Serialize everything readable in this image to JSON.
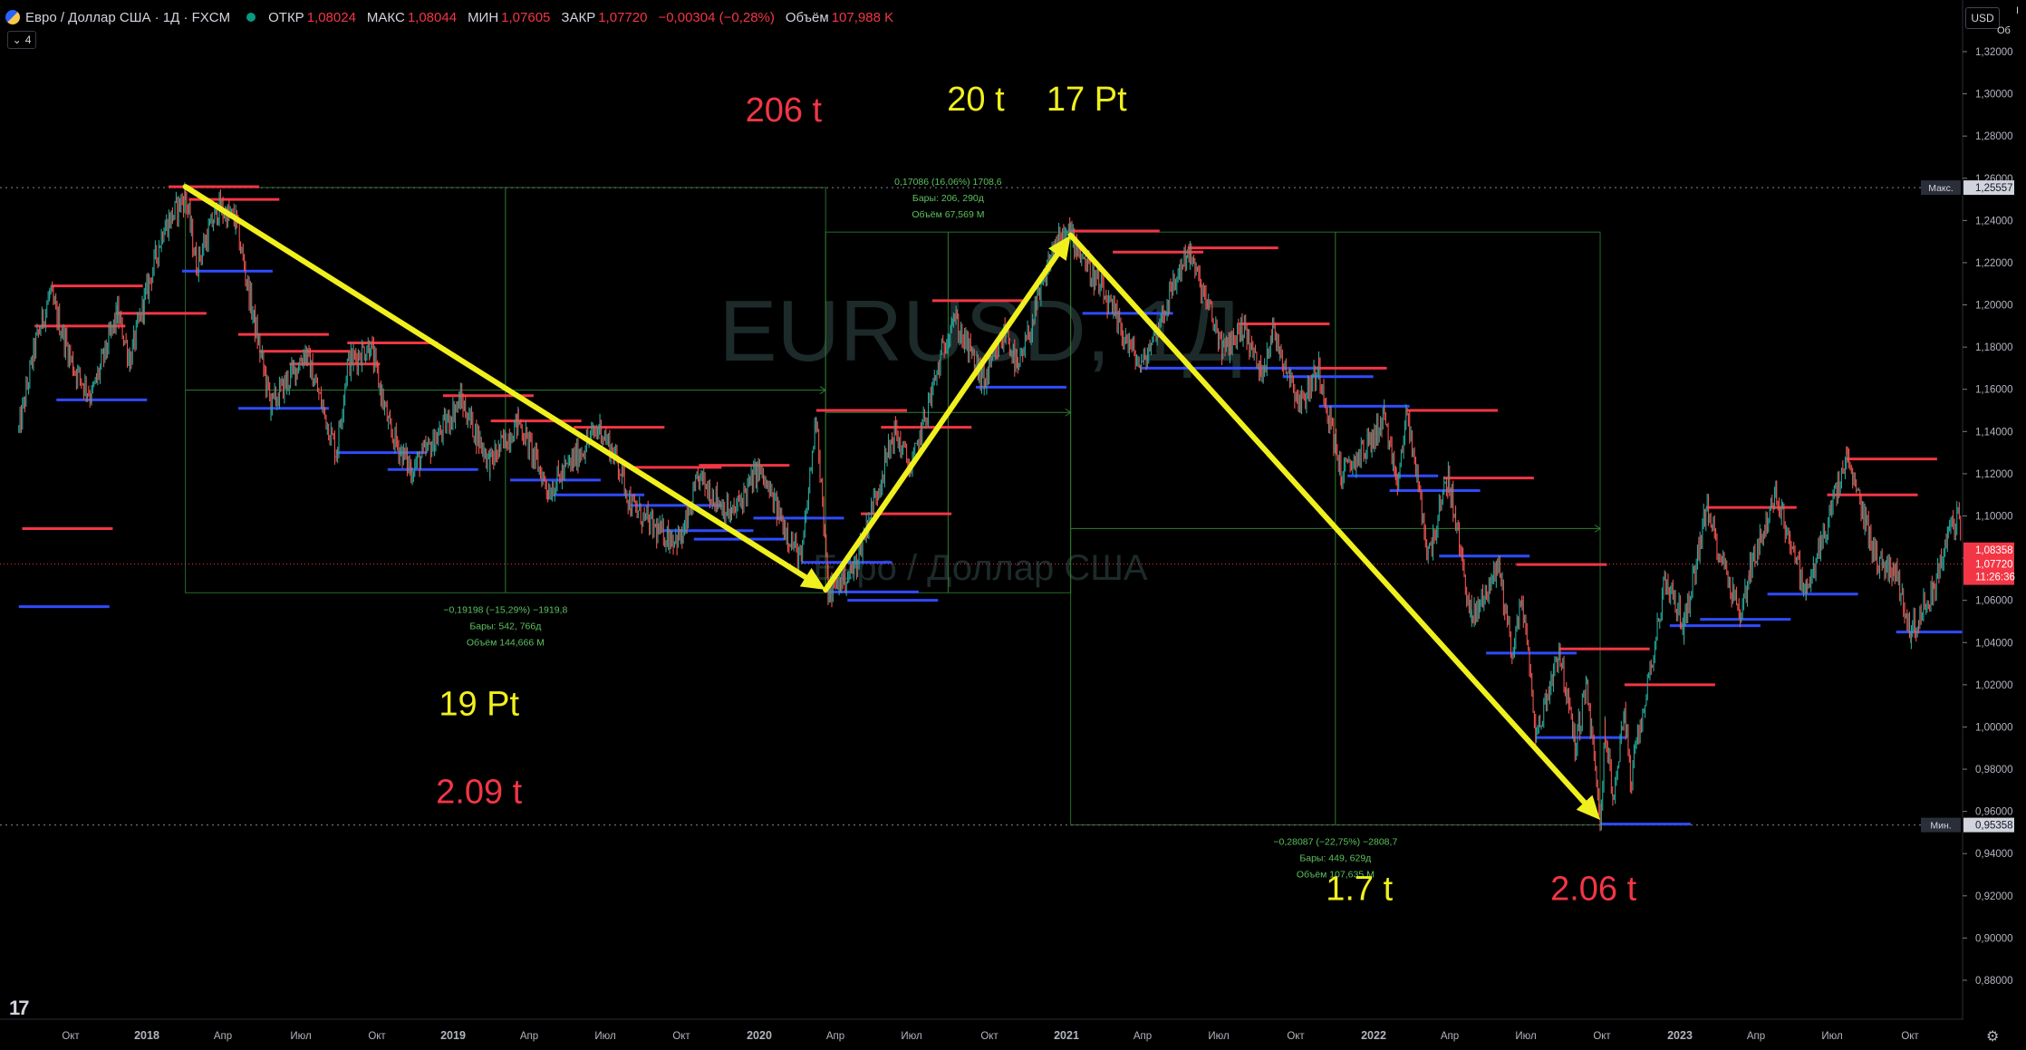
{
  "header": {
    "title": "Евро / Доллар США · 1Д · FXCM",
    "open_label": "ОТКР",
    "open": "1,08024",
    "high_label": "МАКС",
    "high": "1,08044",
    "low_label": "МИН",
    "low": "1,07605",
    "close_label": "ЗАКР",
    "close": "1,07720",
    "change": "−0,00304 (−0,28%)",
    "volume_label": "Объём",
    "volume": "107,988 K"
  },
  "indicator_toggle": {
    "chevron": "⌄",
    "count": "4"
  },
  "currency_button": "USD",
  "edge_chars": [
    "I",
    "Об"
  ],
  "watermark": {
    "symbol": "EURUSD, 1Д",
    "name": "Евро / Доллар США"
  },
  "chart_data": {
    "type": "line",
    "title": "Евро / Доллар США · 1Д · FXCM",
    "ylim": [
      0.87,
      1.335
    ],
    "y_ticks": [
      "1,32000",
      "1,30000",
      "1,28000",
      "1,26000",
      "1,24000",
      "1,22000",
      "1,20000",
      "1,18000",
      "1,16000",
      "1,14000",
      "1,12000",
      "1,10000",
      "1,08000",
      "1,06000",
      "1,04000",
      "1,02000",
      "1,00000",
      "0,98000",
      "0,96000",
      "0,94000",
      "0,92000",
      "0,90000",
      "0,88000"
    ],
    "x_ticks": [
      "Окт",
      "2018",
      "Апр",
      "Июл",
      "Окт",
      "2019",
      "Апр",
      "Июл",
      "Окт",
      "2020",
      "Апр",
      "Июл",
      "Окт",
      "2021",
      "Апр",
      "Июл",
      "Окт",
      "2022",
      "Апр",
      "Июл",
      "Окт",
      "2023",
      "Апр",
      "Июл",
      "Окт"
    ],
    "x_ticks_bold": [
      "2018",
      "2019",
      "2020",
      "2021",
      "2022",
      "2023"
    ],
    "series": [
      {
        "values": [
          [
            "2017-08-01",
            1.14
          ],
          [
            "2017-08-20",
            1.18
          ],
          [
            "2017-09-07",
            1.205
          ],
          [
            "2017-10-06",
            1.17
          ],
          [
            "2017-10-27",
            1.157
          ],
          [
            "2017-11-27",
            1.196
          ],
          [
            "2017-12-12",
            1.174
          ],
          [
            "2017-12-29",
            1.202
          ],
          [
            "2018-01-20",
            1.235
          ],
          [
            "2018-02-16",
            1.252
          ],
          [
            "2018-03-01",
            1.219
          ],
          [
            "2018-03-27",
            1.246
          ],
          [
            "2018-04-17",
            1.24
          ],
          [
            "2018-05-10",
            1.19
          ],
          [
            "2018-05-29",
            1.152
          ],
          [
            "2018-06-14",
            1.162
          ],
          [
            "2018-06-28",
            1.17
          ],
          [
            "2018-07-09",
            1.178
          ],
          [
            "2018-08-15",
            1.13
          ],
          [
            "2018-08-28",
            1.172
          ],
          [
            "2018-09-24",
            1.181
          ],
          [
            "2018-10-18",
            1.14
          ],
          [
            "2018-11-12",
            1.122
          ],
          [
            "2018-12-10",
            1.135
          ],
          [
            "2019-01-10",
            1.155
          ],
          [
            "2019-02-14",
            1.125
          ],
          [
            "2019-03-20",
            1.145
          ],
          [
            "2019-04-25",
            1.112
          ],
          [
            "2019-06-25",
            1.142
          ],
          [
            "2019-07-17",
            1.125
          ],
          [
            "2019-08-01",
            1.105
          ],
          [
            "2019-09-03",
            1.092
          ],
          [
            "2019-10-01",
            1.089
          ],
          [
            "2019-10-21",
            1.118
          ],
          [
            "2019-11-29",
            1.1
          ],
          [
            "2019-12-31",
            1.122
          ],
          [
            "2020-02-20",
            1.078
          ],
          [
            "2020-03-09",
            1.149
          ],
          [
            "2020-03-23",
            1.064
          ],
          [
            "2020-04-23",
            1.075
          ],
          [
            "2020-06-10",
            1.14
          ],
          [
            "2020-06-30",
            1.122
          ],
          [
            "2020-08-18",
            1.195
          ],
          [
            "2020-09-25",
            1.163
          ],
          [
            "2020-10-21",
            1.188
          ],
          [
            "2020-11-04",
            1.168
          ],
          [
            "2020-12-17",
            1.228
          ],
          [
            "2021-01-06",
            1.234
          ],
          [
            "2021-03-31",
            1.17
          ],
          [
            "2021-05-25",
            1.226
          ],
          [
            "2021-07-07",
            1.178
          ],
          [
            "2021-07-30",
            1.19
          ],
          [
            "2021-08-20",
            1.167
          ],
          [
            "2021-09-03",
            1.188
          ],
          [
            "2021-10-06",
            1.153
          ],
          [
            "2021-10-28",
            1.17
          ],
          [
            "2021-11-24",
            1.119
          ],
          [
            "2021-12-30",
            1.136
          ],
          [
            "2022-01-14",
            1.148
          ],
          [
            "2022-01-28",
            1.112
          ],
          [
            "2022-02-10",
            1.149
          ],
          [
            "2022-03-07",
            1.081
          ],
          [
            "2022-03-31",
            1.118
          ],
          [
            "2022-04-28",
            1.05
          ],
          [
            "2022-05-30",
            1.077
          ],
          [
            "2022-06-15",
            1.035
          ],
          [
            "2022-06-27",
            1.061
          ],
          [
            "2022-07-14",
            0.995
          ],
          [
            "2022-08-10",
            1.037
          ],
          [
            "2022-08-29",
            0.991
          ],
          [
            "2022-09-12",
            1.02
          ],
          [
            "2022-09-28",
            0.954
          ],
          [
            "2022-10-04",
            0.999
          ],
          [
            "2022-10-13",
            0.965
          ],
          [
            "2022-10-27",
            1.009
          ],
          [
            "2022-11-03",
            0.973
          ],
          [
            "2022-12-15",
            1.07
          ],
          [
            "2023-01-06",
            1.048
          ],
          [
            "2023-02-01",
            1.103
          ],
          [
            "2023-03-15",
            1.052
          ],
          [
            "2023-03-24",
            1.074
          ],
          [
            "2023-04-26",
            1.11
          ],
          [
            "2023-05-31",
            1.063
          ],
          [
            "2023-07-18",
            1.127
          ],
          [
            "2023-08-25",
            1.077
          ],
          [
            "2023-09-12",
            1.076
          ],
          [
            "2023-10-03",
            1.045
          ],
          [
            "2023-10-30",
            1.066
          ],
          [
            "2023-11-16",
            1.092
          ],
          [
            "2023-11-29",
            1.101
          ],
          [
            "2023-12-01",
            1.077
          ]
        ]
      }
    ],
    "level_lines": {
      "red": [
        [
          "2017-08-05",
          1.094
        ],
        [
          "2017-08-20",
          1.19
        ],
        [
          "2017-09-10",
          1.209
        ],
        [
          "2017-11-25",
          1.196
        ],
        [
          "2018-01-27",
          1.256
        ],
        [
          "2018-02-20",
          1.25
        ],
        [
          "2018-04-20",
          1.186
        ],
        [
          "2018-05-15",
          1.178
        ],
        [
          "2018-06-20",
          1.172
        ],
        [
          "2018-08-28",
          1.182
        ],
        [
          "2018-12-20",
          1.157
        ],
        [
          "2019-02-15",
          1.145
        ],
        [
          "2019-05-25",
          1.142
        ],
        [
          "2019-08-01",
          1.123
        ],
        [
          "2019-10-21",
          1.124
        ],
        [
          "2020-03-09",
          1.15
        ],
        [
          "2020-05-01",
          1.101
        ],
        [
          "2020-05-25",
          1.142
        ],
        [
          "2020-07-25",
          1.202
        ],
        [
          "2021-01-04",
          1.235
        ],
        [
          "2021-02-25",
          1.225
        ],
        [
          "2021-05-25",
          1.227
        ],
        [
          "2021-07-25",
          1.191
        ],
        [
          "2021-10-01",
          1.17
        ],
        [
          "2022-02-10",
          1.15
        ],
        [
          "2022-03-25",
          1.118
        ],
        [
          "2022-06-20",
          1.077
        ],
        [
          "2022-08-10",
          1.037
        ],
        [
          "2022-10-27",
          1.02
        ],
        [
          "2023-02-01",
          1.104
        ],
        [
          "2023-06-25",
          1.11
        ],
        [
          "2023-07-18",
          1.127
        ]
      ],
      "blue": [
        [
          "2017-08-01",
          1.057
        ],
        [
          "2017-09-15",
          1.155
        ],
        [
          "2018-02-12",
          1.216
        ],
        [
          "2018-04-20",
          1.151
        ],
        [
          "2018-08-15",
          1.13
        ],
        [
          "2018-10-15",
          1.122
        ],
        [
          "2019-03-10",
          1.117
        ],
        [
          "2019-05-01",
          1.11
        ],
        [
          "2019-08-01",
          1.105
        ],
        [
          "2019-09-08",
          1.093
        ],
        [
          "2019-10-15",
          1.089
        ],
        [
          "2019-12-25",
          1.099
        ],
        [
          "2020-02-20",
          1.078
        ],
        [
          "2020-03-23",
          1.064
        ],
        [
          "2020-04-15",
          1.06
        ],
        [
          "2020-09-15",
          1.161
        ],
        [
          "2021-01-20",
          1.196
        ],
        [
          "2021-03-31",
          1.17
        ],
        [
          "2021-07-07",
          1.17
        ],
        [
          "2021-09-15",
          1.166
        ],
        [
          "2021-10-28",
          1.152
        ],
        [
          "2021-12-01",
          1.119
        ],
        [
          "2022-01-20",
          1.112
        ],
        [
          "2022-03-20",
          1.081
        ],
        [
          "2022-05-15",
          1.035
        ],
        [
          "2022-07-14",
          0.995
        ],
        [
          "2022-09-28",
          0.954
        ],
        [
          "2022-12-20",
          1.048
        ],
        [
          "2023-01-25",
          1.051
        ],
        [
          "2023-04-15",
          1.063
        ],
        [
          "2023-09-15",
          1.045
        ]
      ]
    },
    "highlight_lines": [
      {
        "label": "Макс.",
        "value": "1,25557",
        "y": 1.25557
      },
      {
        "label": "Мин.",
        "value": "0,95358",
        "y": 0.95358
      }
    ],
    "current_price": {
      "value": "1,07720",
      "countdown": "11:26:36",
      "y": 1.0772
    },
    "prior_close": {
      "value": "1,08358",
      "y": 1.08358
    },
    "measure_tools": [
      {
        "x1": "2018-02-16",
        "x2": "2020-03-20",
        "y1": 1.2556,
        "y2": 1.0636,
        "color": "#ff5252",
        "lines": [
          "−0,19198 (−15,29%) −1919,8",
          "Бары: 542, 766д",
          "Объём 144,666 M"
        ],
        "label_pos": "below"
      },
      {
        "x1": "2020-03-20",
        "x2": "2021-01-06",
        "y1": 1.0636,
        "y2": 1.2345,
        "color": "#089981",
        "lines": [
          "0,17086 (16,06%) 1708,6",
          "Бары: 206, 290д",
          "Объём 67,569 M"
        ],
        "label_pos": "above"
      },
      {
        "x1": "2021-01-06",
        "x2": "2022-09-28",
        "y1": 1.2345,
        "y2": 0.9536,
        "color": "#ff5252",
        "lines": [
          "−0,28087 (−22,75%) −2808,7",
          "Бары: 449, 629д",
          "Объём 107,635 M"
        ],
        "label_pos": "below"
      }
    ],
    "arrows": [
      {
        "from": [
          "2018-02-16",
          1.256
        ],
        "to": [
          "2020-03-20",
          1.065
        ]
      },
      {
        "from": [
          "2020-03-20",
          1.065
        ],
        "to": [
          "2021-01-06",
          1.233
        ]
      },
      {
        "from": [
          "2021-01-06",
          1.233
        ],
        "to": [
          "2022-09-28",
          0.956
        ]
      }
    ],
    "annotations": [
      {
        "text": "206 t",
        "color": "#f23645",
        "x": "2020-01-30",
        "y": 1.287
      },
      {
        "text": "20 t",
        "color": "#f0f01e",
        "x": "2020-09-15",
        "y": 1.292
      },
      {
        "text": "17 Pt",
        "color": "#f0f01e",
        "x": "2021-01-25",
        "y": 1.292
      },
      {
        "text": "19 Pt",
        "color": "#f0f01e",
        "x": "2019-02-01",
        "y": 1.0055
      },
      {
        "text": "2.09 t",
        "color": "#f23645",
        "x": "2019-02-01",
        "y": 0.964
      },
      {
        "text": "1.7 t",
        "color": "#f0f01e",
        "x": "2021-12-15",
        "y": 0.918
      },
      {
        "text": "2.06 t",
        "color": "#f23645",
        "x": "2022-09-20",
        "y": 0.918
      }
    ]
  }
}
